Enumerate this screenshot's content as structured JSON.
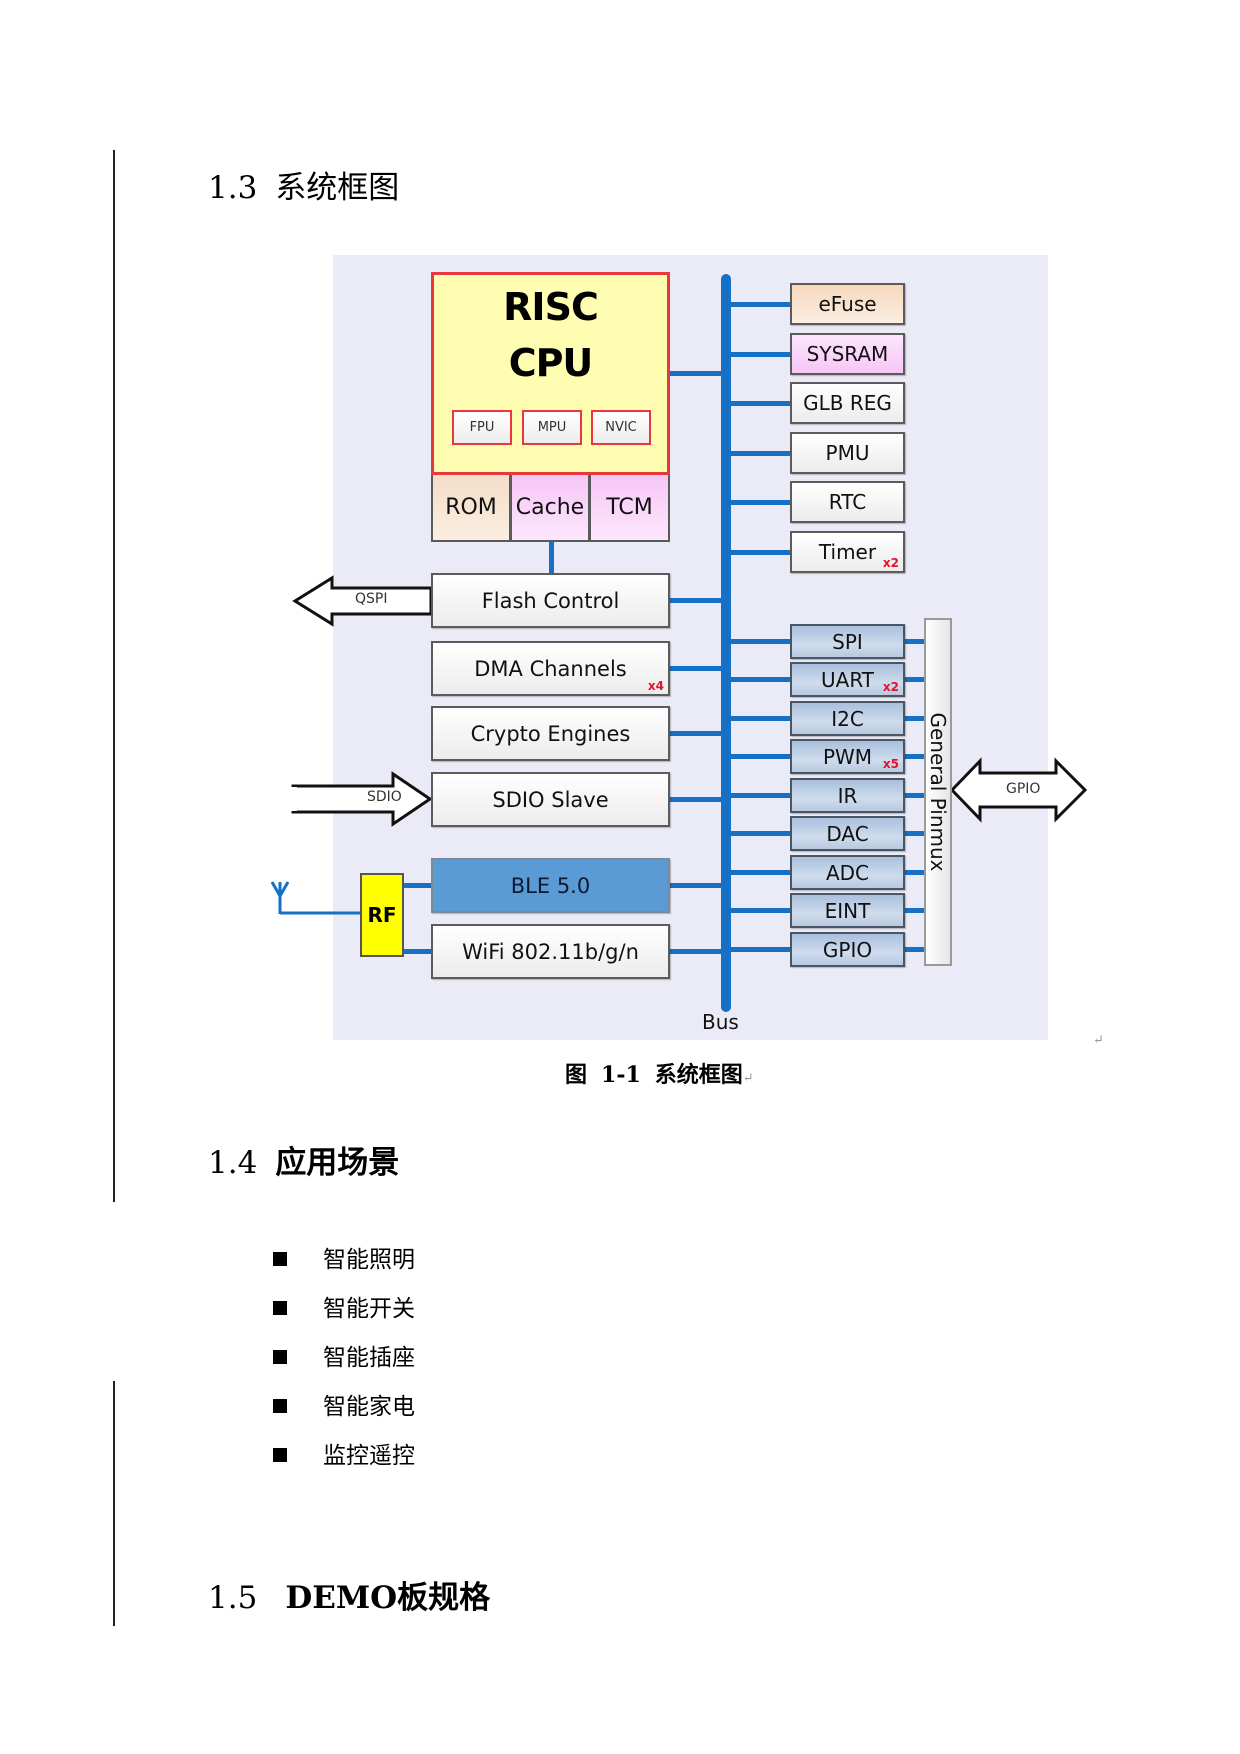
{
  "sections": {
    "s13": {
      "number": "1.3",
      "title": "系统框图"
    },
    "s14": {
      "number": "1.4",
      "title": "应用场景"
    },
    "s15": {
      "number": "1.5",
      "title": "DEMO板规格"
    }
  },
  "diagram": {
    "cpu": {
      "title_line1": "RISC",
      "title_line2": "CPU",
      "sub_units": [
        "FPU",
        "MPU",
        "NVIC"
      ]
    },
    "memory": [
      "ROM",
      "Cache",
      "TCM"
    ],
    "left_blocks": [
      {
        "label": "Flash Control",
        "mult": ""
      },
      {
        "label": "DMA Channels",
        "mult": "x4"
      },
      {
        "label": "Crypto Engines",
        "mult": ""
      },
      {
        "label": "SDIO Slave",
        "mult": ""
      },
      {
        "label": "BLE 5.0",
        "mult": ""
      },
      {
        "label": "WiFi 802.11b/g/n",
        "mult": ""
      }
    ],
    "system_blocks": [
      {
        "label": "eFuse",
        "mult": ""
      },
      {
        "label": "SYSRAM",
        "mult": ""
      },
      {
        "label": "GLB REG",
        "mult": ""
      },
      {
        "label": "PMU",
        "mult": ""
      },
      {
        "label": "RTC",
        "mult": ""
      },
      {
        "label": "Timer",
        "mult": "x2"
      }
    ],
    "peripherals": [
      {
        "label": "SPI",
        "mult": ""
      },
      {
        "label": "UART",
        "mult": "x2"
      },
      {
        "label": "I2C",
        "mult": ""
      },
      {
        "label": "PWM",
        "mult": "x5"
      },
      {
        "label": "IR",
        "mult": ""
      },
      {
        "label": "DAC",
        "mult": ""
      },
      {
        "label": "ADC",
        "mult": ""
      },
      {
        "label": "EINT",
        "mult": ""
      },
      {
        "label": "GPIO",
        "mult": ""
      }
    ],
    "pinmux_label": "General Pinmux",
    "bus_label": "Bus",
    "rf_label": "RF",
    "qspi_label": "QSPI",
    "sdio_label": "SDIO",
    "gpio_label": "GPIO",
    "colors": {
      "bus": "#1670c5",
      "cpu_fill": "#fefdb2",
      "cpu_border": "#e8383d",
      "rom_fill": "#f7e0cb",
      "cache_fill": "#f8ccf8",
      "ble_fill": "#5b9bd5",
      "rf_fill": "#ffff00",
      "peripheral_fill": "#bccde4",
      "mult_text": "#e0142c",
      "background": "#ebebf7"
    }
  },
  "caption": {
    "prefix": "图",
    "number": "1-1",
    "title": "系统框图"
  },
  "applications": [
    "智能照明",
    "智能开关",
    "智能插座",
    "智能家电",
    "监控遥控"
  ]
}
